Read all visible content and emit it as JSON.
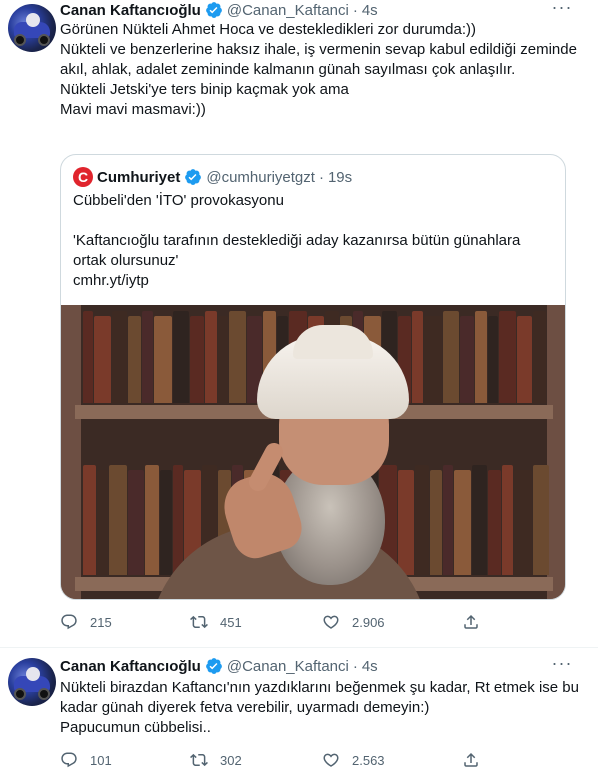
{
  "tweets": [
    {
      "author": {
        "name": "Canan Kaftancıoğlu",
        "handle": "@Canan_Kaftanci",
        "time": "4s",
        "verified": true
      },
      "text": "Görünen  Nükteli Ahmet Hoca ve destekledikleri zor durumda:))\nNükteli ve benzerlerine haksız ihale, iş vermenin sevap kabul edildiği zeminde akıl, ahlak, adalet zemininde kalmanın günah sayılması çok anlaşılır.\nNükteli Jetski'ye ters binip kaçmak yok ama\nMavi mavi masmavi:))",
      "quote": {
        "author": {
          "logo": "C",
          "name": "Cumhuriyet",
          "handle": "@cumhuriyetgzt",
          "time": "19s",
          "verified": true
        },
        "text": "Cübbeli'den 'İTO' provokasyonu\n\n'Kaftancıoğlu tarafının desteklediği aday kazanırsa bütün günahlara ortak olursunuz'\ncmhr.yt/iytp"
      },
      "stats": {
        "replies": "215",
        "retweets": "451",
        "likes": "2.906"
      }
    },
    {
      "author": {
        "name": "Canan Kaftancıoğlu",
        "handle": "@Canan_Kaftanci",
        "time": "4s",
        "verified": true
      },
      "text": "Nükteli birazdan Kaftancı'nın yazdıklarını beğenmek şu kadar, Rt etmek ise bu kadar günah diyerek fetva verebilir, uyarmadı demeyin:)\nPapucumun cübbelisi..",
      "stats": {
        "replies": "101",
        "retweets": "302",
        "likes": "2.563"
      }
    }
  ],
  "colors": {
    "accent": "#1d9bf0",
    "text": "#0f1419",
    "muted": "#536471",
    "border": "#cfd9de",
    "brand_cumhuriyet": "#e0242d"
  },
  "icons": {
    "more": "more-icon",
    "verified": "verified-badge-icon",
    "reply": "reply-icon",
    "retweet": "retweet-icon",
    "like": "like-icon",
    "share": "share-icon"
  }
}
